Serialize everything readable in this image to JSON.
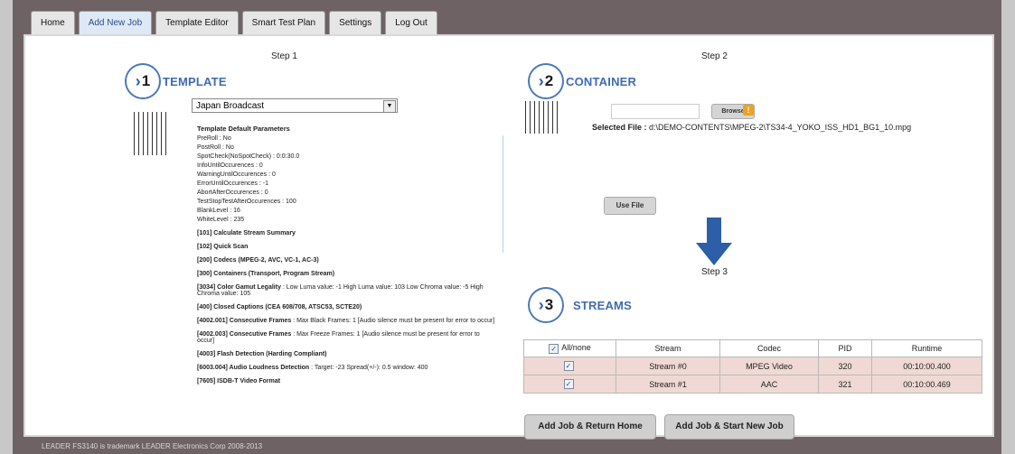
{
  "tabs": [
    "Home",
    "Add New Job",
    "Template Editor",
    "Smart Test Plan",
    "Settings",
    "Log Out"
  ],
  "step1": {
    "label": "Step 1",
    "number": "1",
    "title": "TEMPLATE",
    "select_value": "Japan Broadcast",
    "params_title": "Template Default Parameters",
    "params": [
      "PreRoll : No",
      "PostRoll : No",
      "SpotCheck(NoSpotCheck) : 0:0:30.0",
      "InfoUntilOccurences : 0",
      "WarningUntilOccurences : 0",
      "ErrorUntilOccurences : -1",
      "AbortAfterOccurences : 0",
      "TestStopTestAfterOccurences : 100",
      "BlankLevel : 16",
      "WhiteLevel : 235"
    ],
    "tests": [
      {
        "name": "[101] Calculate Stream Summary",
        "desc": ""
      },
      {
        "name": "[102] Quick Scan",
        "desc": ""
      },
      {
        "name": "[200] Codecs (MPEG-2, AVC, VC-1, AC-3)",
        "desc": ""
      },
      {
        "name": "[300] Containers (Transport, Program Stream)",
        "desc": ""
      },
      {
        "name": "[3034] Color Gamut Legality",
        "desc": " : Low Luma value: -1 High Luma value: 103 Low Chroma value: -5 High Chroma value: 105"
      },
      {
        "name": "[400] Closed Captions (CEA 608/708, ATSC53, SCTE20)",
        "desc": ""
      },
      {
        "name": "[4002.001] Consecutive Frames",
        "desc": " : Max Black Frames: 1 [Audio silence must be present for error to occur]"
      },
      {
        "name": "[4002.003] Consecutive Frames",
        "desc": " : Max Freeze Frames: 1 [Audio silence must be present for error to occur]"
      },
      {
        "name": "[4003] Flash Detection (Harding Compliant)",
        "desc": ""
      },
      {
        "name": "[6003.004] Audio Loudness Detection",
        "desc": " : Target: -23 Spread(+/-): 0.5 window: 400"
      },
      {
        "name": "[7605] ISDB-T Video Format",
        "desc": ""
      }
    ]
  },
  "step2": {
    "label": "Step 2",
    "number": "2",
    "title": "CONTAINER",
    "browse_label": "Browse",
    "warning_glyph": "!",
    "selected_file_label": "Selected File :",
    "selected_file_path": "d:\\DEMO-CONTENTS\\MPEG-2\\TS34-4_YOKO_ISS_HD1_BG1_10.mpg",
    "use_file_label": "Use File"
  },
  "step3": {
    "label": "Step 3",
    "number": "3",
    "title": "STREAMS",
    "columns": [
      "All/none",
      "Stream",
      "Codec",
      "PID",
      "Runtime"
    ],
    "rows": [
      {
        "checked": true,
        "stream": "Stream #0",
        "codec": "MPEG Video",
        "pid": "320",
        "runtime": "00:10:00.400"
      },
      {
        "checked": true,
        "stream": "Stream #1",
        "codec": "AAC",
        "pid": "321",
        "runtime": "00:10:00.469"
      }
    ]
  },
  "actions": {
    "add_return": "Add Job & Return Home",
    "add_new": "Add Job & Start New Job"
  },
  "footer": "LEADER FS3140 is trademark LEADER Electronics Corp 2008-2013",
  "colors": {
    "frame": "#6e6264",
    "accent_blue": "#2c5fa7",
    "row_fill": "#f0d9d4",
    "warning": "#f0a21c"
  }
}
